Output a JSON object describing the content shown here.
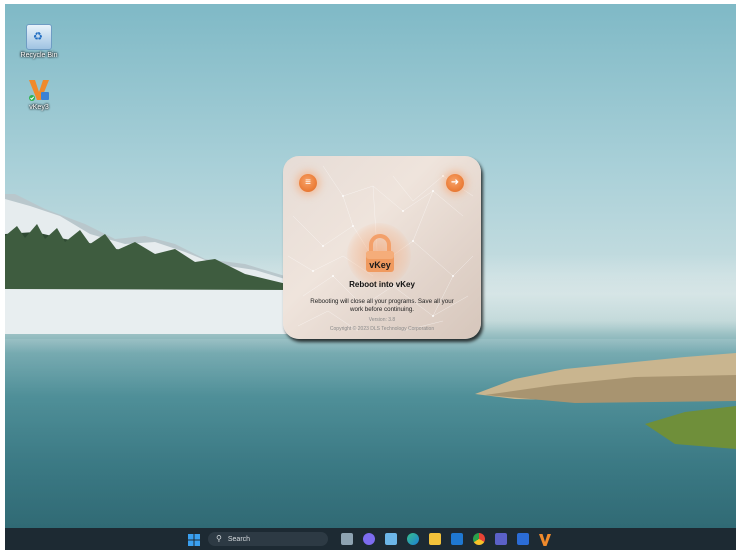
{
  "desktop": {
    "icons": [
      {
        "label": "Recycle Bin",
        "icon": "recycle-bin-icon"
      },
      {
        "label": "vKey3",
        "icon": "vkey-app-icon"
      }
    ]
  },
  "dialog": {
    "title": "Reboot into vKey",
    "logo_text": "vKey",
    "message": "Rebooting will close all your programs. Save all your work before continuing.",
    "version": "Version: 3.8",
    "copyright": "Copyright © 2023 DLS Technology Corporation",
    "menu_icon": "menu-icon",
    "exit_icon": "exit-icon",
    "accent": "#ee7f3c"
  },
  "taskbar": {
    "search_placeholder": "Search",
    "apps": [
      "start-icon",
      "task-view-icon",
      "chat-icon",
      "photos-icon",
      "edge-icon",
      "file-explorer-icon",
      "outlook-icon",
      "chrome-icon",
      "teams-icon",
      "word-icon",
      "vkey-taskbar-icon"
    ]
  }
}
